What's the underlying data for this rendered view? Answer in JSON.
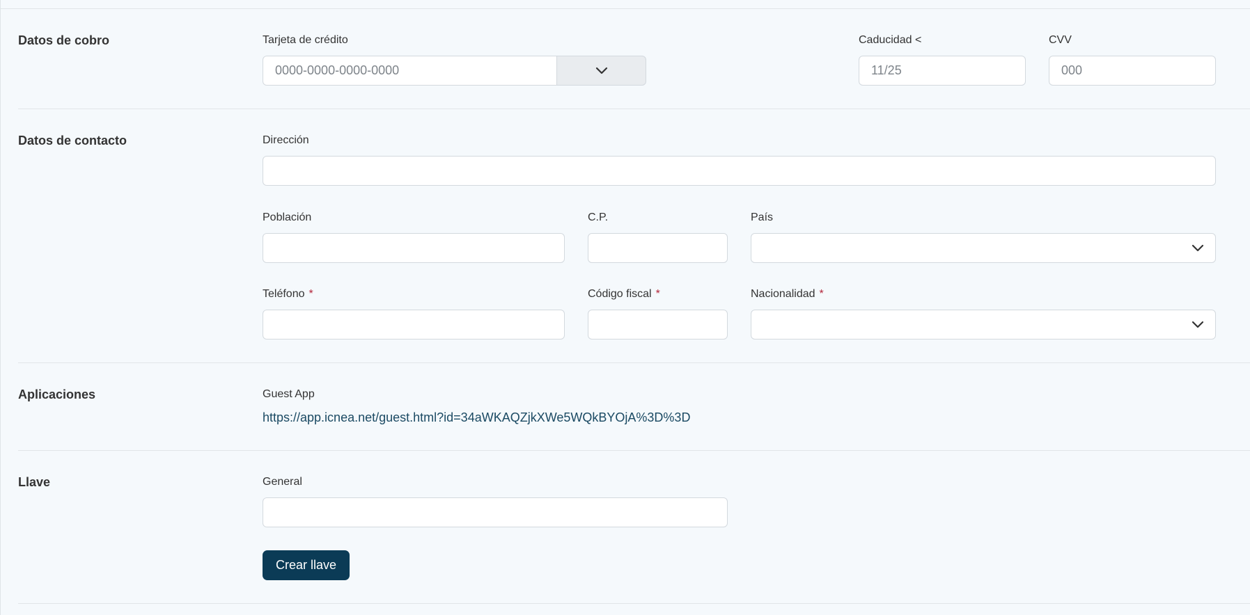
{
  "billing": {
    "section_title": "Datos de cobro",
    "card_label": "Tarjeta de crédito",
    "card_placeholder": "0000-0000-0000-0000",
    "expiry_label": "Caducidad <",
    "expiry_placeholder": "11/25",
    "cvv_label": "CVV",
    "cvv_placeholder": "000"
  },
  "contact": {
    "section_title": "Datos de contacto",
    "address_label": "Dirección",
    "city_label": "Población",
    "zip_label": "C.P.",
    "country_label": "País",
    "phone_label": "Teléfono",
    "tax_code_label": "Código fiscal",
    "nationality_label": "Nacionalidad",
    "required_mark": "*"
  },
  "apps": {
    "section_title": "Aplicaciones",
    "guest_app_label": "Guest App",
    "guest_app_url": "https://app.icnea.net/guest.html?id=34aWKAQZjkXWe5WQkBYOjA%3D%3D"
  },
  "key": {
    "section_title": "Llave",
    "general_label": "General",
    "create_button": "Crear llave"
  },
  "icons": {
    "chevron": "chevron-down-icon"
  }
}
